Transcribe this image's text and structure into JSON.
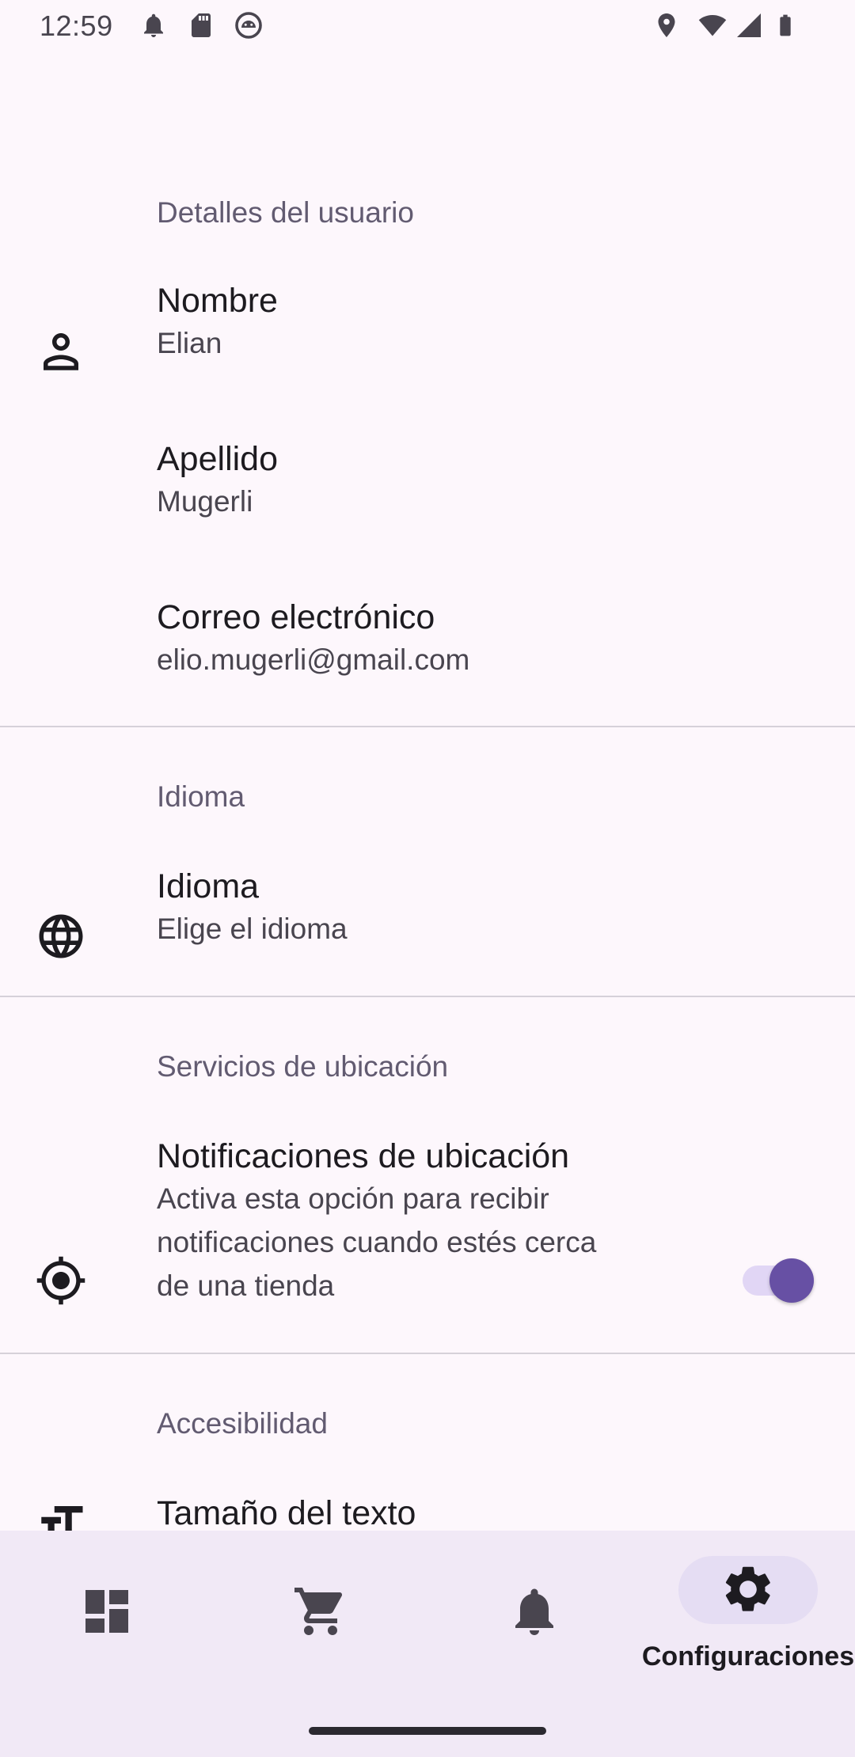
{
  "status_bar": {
    "time": "12:59",
    "left_icons": [
      "notification-bell-icon",
      "sd-card-icon",
      "android-head-icon"
    ],
    "right_icons": [
      "location-pin-icon",
      "wifi-icon",
      "signal-icon",
      "battery-icon"
    ]
  },
  "sections": {
    "user_details": {
      "header": "Detalles del usuario",
      "items": [
        {
          "title": "Nombre",
          "subtitle": "Elian",
          "icon": "person-icon"
        },
        {
          "title": "Apellido",
          "subtitle": "Mugerli"
        },
        {
          "title": "Correo electrónico",
          "subtitle": "elio.mugerli@gmail.com"
        }
      ]
    },
    "language": {
      "header": "Idioma",
      "item": {
        "title": "Idioma",
        "subtitle": "Elige el idioma",
        "icon": "globe-icon"
      }
    },
    "location": {
      "header": "Servicios de ubicación",
      "item": {
        "title": "Notificaciones de ubicación",
        "subtitle_lines": [
          "Activa esta opción para recibir",
          "notificaciones cuando estés cerca",
          "de una tienda"
        ],
        "icon": "gps-target-icon",
        "toggle_on": true
      }
    },
    "accessibility": {
      "header": "Accesibilidad",
      "item": {
        "title": "Tamaño del texto",
        "icon": "text-size-icon"
      }
    }
  },
  "bottom_nav": {
    "items": [
      {
        "icon": "dashboard-icon",
        "label": ""
      },
      {
        "icon": "cart-icon",
        "label": ""
      },
      {
        "icon": "bell-icon",
        "label": ""
      },
      {
        "icon": "gear-icon",
        "label": "Configuraciones",
        "active": true
      }
    ]
  },
  "colors": {
    "background": "#fdf7fc",
    "accent": "#6750a4",
    "nav_background": "#f1e9f6",
    "active_pill": "#e5ddf3"
  }
}
